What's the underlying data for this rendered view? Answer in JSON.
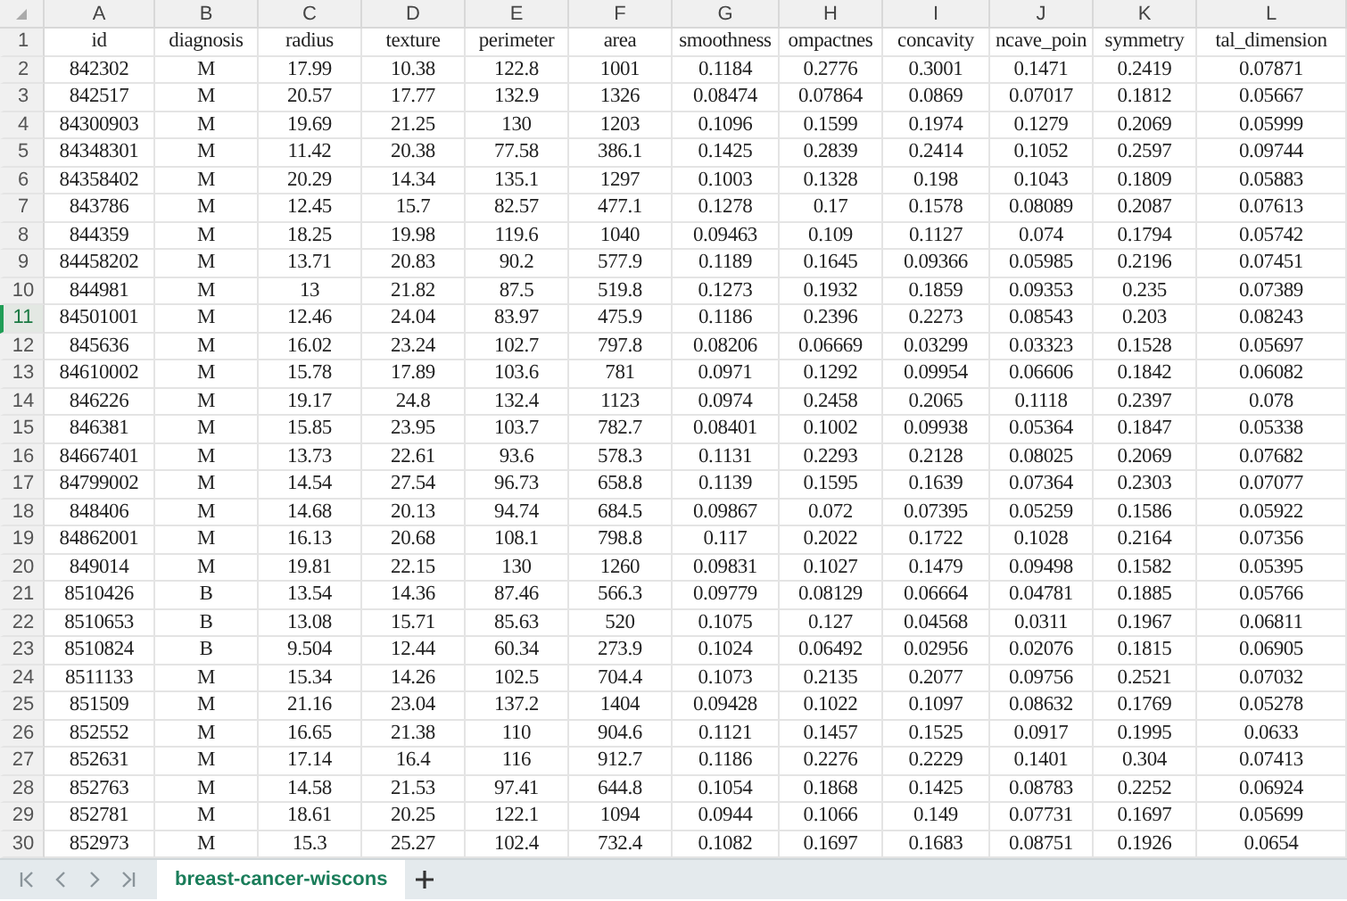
{
  "columns": [
    "A",
    "B",
    "C",
    "D",
    "E",
    "F",
    "G",
    "H",
    "I",
    "J",
    "K",
    "L"
  ],
  "rows": [
    {
      "num": "1",
      "selected": false,
      "cells": [
        "id",
        "diagnosis",
        "radius",
        "texture",
        "perimeter",
        "area",
        "smoothness",
        "ompactnes",
        "concavity",
        "ncave_poin",
        "symmetry",
        "tal_dimension"
      ]
    },
    {
      "num": "2",
      "selected": false,
      "cells": [
        "842302",
        "M",
        "17.99",
        "10.38",
        "122.8",
        "1001",
        "0.1184",
        "0.2776",
        "0.3001",
        "0.1471",
        "0.2419",
        "0.07871"
      ]
    },
    {
      "num": "3",
      "selected": false,
      "cells": [
        "842517",
        "M",
        "20.57",
        "17.77",
        "132.9",
        "1326",
        "0.08474",
        "0.07864",
        "0.0869",
        "0.07017",
        "0.1812",
        "0.05667"
      ]
    },
    {
      "num": "4",
      "selected": false,
      "cells": [
        "84300903",
        "M",
        "19.69",
        "21.25",
        "130",
        "1203",
        "0.1096",
        "0.1599",
        "0.1974",
        "0.1279",
        "0.2069",
        "0.05999"
      ]
    },
    {
      "num": "5",
      "selected": false,
      "cells": [
        "84348301",
        "M",
        "11.42",
        "20.38",
        "77.58",
        "386.1",
        "0.1425",
        "0.2839",
        "0.2414",
        "0.1052",
        "0.2597",
        "0.09744"
      ]
    },
    {
      "num": "6",
      "selected": false,
      "cells": [
        "84358402",
        "M",
        "20.29",
        "14.34",
        "135.1",
        "1297",
        "0.1003",
        "0.1328",
        "0.198",
        "0.1043",
        "0.1809",
        "0.05883"
      ]
    },
    {
      "num": "7",
      "selected": false,
      "cells": [
        "843786",
        "M",
        "12.45",
        "15.7",
        "82.57",
        "477.1",
        "0.1278",
        "0.17",
        "0.1578",
        "0.08089",
        "0.2087",
        "0.07613"
      ]
    },
    {
      "num": "8",
      "selected": false,
      "cells": [
        "844359",
        "M",
        "18.25",
        "19.98",
        "119.6",
        "1040",
        "0.09463",
        "0.109",
        "0.1127",
        "0.074",
        "0.1794",
        "0.05742"
      ]
    },
    {
      "num": "9",
      "selected": false,
      "cells": [
        "84458202",
        "M",
        "13.71",
        "20.83",
        "90.2",
        "577.9",
        "0.1189",
        "0.1645",
        "0.09366",
        "0.05985",
        "0.2196",
        "0.07451"
      ]
    },
    {
      "num": "10",
      "selected": false,
      "cells": [
        "844981",
        "M",
        "13",
        "21.82",
        "87.5",
        "519.8",
        "0.1273",
        "0.1932",
        "0.1859",
        "0.09353",
        "0.235",
        "0.07389"
      ]
    },
    {
      "num": "11",
      "selected": true,
      "cells": [
        "84501001",
        "M",
        "12.46",
        "24.04",
        "83.97",
        "475.9",
        "0.1186",
        "0.2396",
        "0.2273",
        "0.08543",
        "0.203",
        "0.08243"
      ]
    },
    {
      "num": "12",
      "selected": false,
      "cells": [
        "845636",
        "M",
        "16.02",
        "23.24",
        "102.7",
        "797.8",
        "0.08206",
        "0.06669",
        "0.03299",
        "0.03323",
        "0.1528",
        "0.05697"
      ]
    },
    {
      "num": "13",
      "selected": false,
      "cells": [
        "84610002",
        "M",
        "15.78",
        "17.89",
        "103.6",
        "781",
        "0.0971",
        "0.1292",
        "0.09954",
        "0.06606",
        "0.1842",
        "0.06082"
      ]
    },
    {
      "num": "14",
      "selected": false,
      "cells": [
        "846226",
        "M",
        "19.17",
        "24.8",
        "132.4",
        "1123",
        "0.0974",
        "0.2458",
        "0.2065",
        "0.1118",
        "0.2397",
        "0.078"
      ]
    },
    {
      "num": "15",
      "selected": false,
      "cells": [
        "846381",
        "M",
        "15.85",
        "23.95",
        "103.7",
        "782.7",
        "0.08401",
        "0.1002",
        "0.09938",
        "0.05364",
        "0.1847",
        "0.05338"
      ]
    },
    {
      "num": "16",
      "selected": false,
      "cells": [
        "84667401",
        "M",
        "13.73",
        "22.61",
        "93.6",
        "578.3",
        "0.1131",
        "0.2293",
        "0.2128",
        "0.08025",
        "0.2069",
        "0.07682"
      ]
    },
    {
      "num": "17",
      "selected": false,
      "cells": [
        "84799002",
        "M",
        "14.54",
        "27.54",
        "96.73",
        "658.8",
        "0.1139",
        "0.1595",
        "0.1639",
        "0.07364",
        "0.2303",
        "0.07077"
      ]
    },
    {
      "num": "18",
      "selected": false,
      "cells": [
        "848406",
        "M",
        "14.68",
        "20.13",
        "94.74",
        "684.5",
        "0.09867",
        "0.072",
        "0.07395",
        "0.05259",
        "0.1586",
        "0.05922"
      ]
    },
    {
      "num": "19",
      "selected": false,
      "cells": [
        "84862001",
        "M",
        "16.13",
        "20.68",
        "108.1",
        "798.8",
        "0.117",
        "0.2022",
        "0.1722",
        "0.1028",
        "0.2164",
        "0.07356"
      ]
    },
    {
      "num": "20",
      "selected": false,
      "cells": [
        "849014",
        "M",
        "19.81",
        "22.15",
        "130",
        "1260",
        "0.09831",
        "0.1027",
        "0.1479",
        "0.09498",
        "0.1582",
        "0.05395"
      ]
    },
    {
      "num": "21",
      "selected": false,
      "cells": [
        "8510426",
        "B",
        "13.54",
        "14.36",
        "87.46",
        "566.3",
        "0.09779",
        "0.08129",
        "0.06664",
        "0.04781",
        "0.1885",
        "0.05766"
      ]
    },
    {
      "num": "22",
      "selected": false,
      "cells": [
        "8510653",
        "B",
        "13.08",
        "15.71",
        "85.63",
        "520",
        "0.1075",
        "0.127",
        "0.04568",
        "0.0311",
        "0.1967",
        "0.06811"
      ]
    },
    {
      "num": "23",
      "selected": false,
      "cells": [
        "8510824",
        "B",
        "9.504",
        "12.44",
        "60.34",
        "273.9",
        "0.1024",
        "0.06492",
        "0.02956",
        "0.02076",
        "0.1815",
        "0.06905"
      ]
    },
    {
      "num": "24",
      "selected": false,
      "cells": [
        "8511133",
        "M",
        "15.34",
        "14.26",
        "102.5",
        "704.4",
        "0.1073",
        "0.2135",
        "0.2077",
        "0.09756",
        "0.2521",
        "0.07032"
      ]
    },
    {
      "num": "25",
      "selected": false,
      "cells": [
        "851509",
        "M",
        "21.16",
        "23.04",
        "137.2",
        "1404",
        "0.09428",
        "0.1022",
        "0.1097",
        "0.08632",
        "0.1769",
        "0.05278"
      ]
    },
    {
      "num": "26",
      "selected": false,
      "cells": [
        "852552",
        "M",
        "16.65",
        "21.38",
        "110",
        "904.6",
        "0.1121",
        "0.1457",
        "0.1525",
        "0.0917",
        "0.1995",
        "0.0633"
      ]
    },
    {
      "num": "27",
      "selected": false,
      "cells": [
        "852631",
        "M",
        "17.14",
        "16.4",
        "116",
        "912.7",
        "0.1186",
        "0.2276",
        "0.2229",
        "0.1401",
        "0.304",
        "0.07413"
      ]
    },
    {
      "num": "28",
      "selected": false,
      "cells": [
        "852763",
        "M",
        "14.58",
        "21.53",
        "97.41",
        "644.8",
        "0.1054",
        "0.1868",
        "0.1425",
        "0.08783",
        "0.2252",
        "0.06924"
      ]
    },
    {
      "num": "29",
      "selected": false,
      "cells": [
        "852781",
        "M",
        "18.61",
        "20.25",
        "122.1",
        "1094",
        "0.0944",
        "0.1066",
        "0.149",
        "0.07731",
        "0.1697",
        "0.05699"
      ]
    },
    {
      "num": "30",
      "selected": false,
      "cells": [
        "852973",
        "M",
        "15.3",
        "25.27",
        "102.4",
        "732.4",
        "0.1082",
        "0.1697",
        "0.1683",
        "0.08751",
        "0.1926",
        "0.0654"
      ]
    }
  ],
  "sheet_tabs": [
    {
      "label": "breast-cancer-wiscons",
      "selected": true
    }
  ]
}
